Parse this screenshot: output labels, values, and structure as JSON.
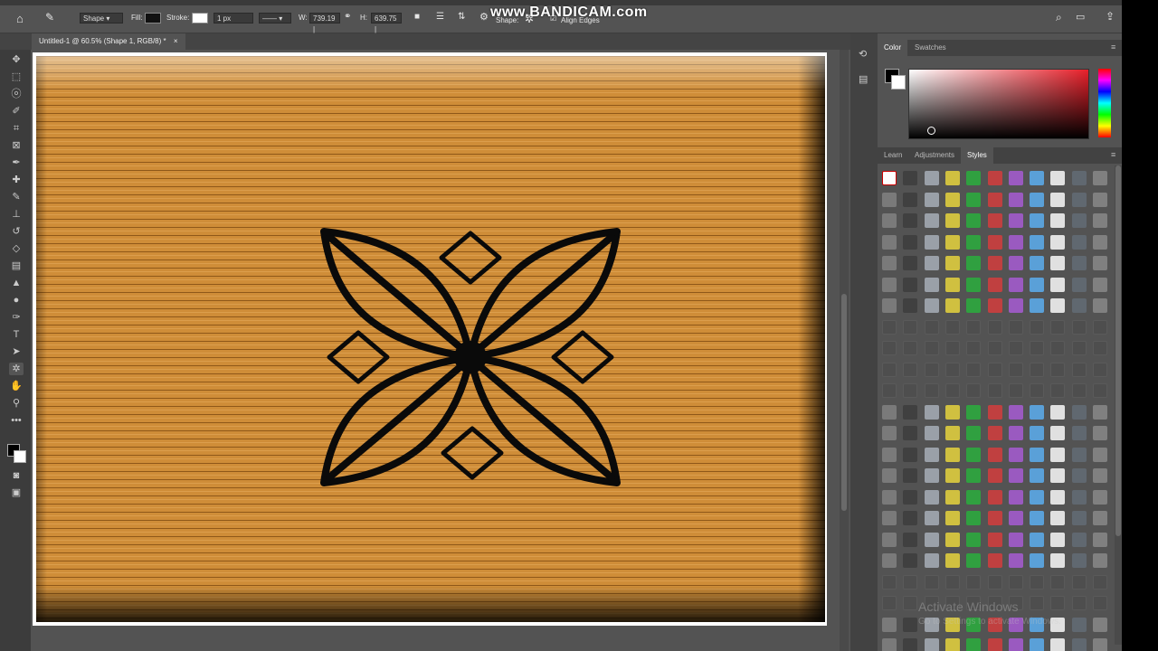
{
  "watermark": "www.BANDICAM.com",
  "options_bar": {
    "shape_mode": "Shape",
    "fill_label": "Fill:",
    "stroke_label": "Stroke:",
    "stroke_width": "1 px",
    "width_label": "W:",
    "width_value": "739.19 |",
    "height_label": "H:",
    "height_value": "639.75 |",
    "shape_label": "Shape:",
    "align_edges_label": "Align Edges"
  },
  "document_tab": {
    "title": "Untitled-1 @ 60.5% (Shape 1, RGB/8) *",
    "close": "×"
  },
  "tools": [
    "move-tool",
    "marquee-tool",
    "lasso-tool",
    "quick-select-tool",
    "crop-tool",
    "frame-tool",
    "eyedropper-tool",
    "healing-tool",
    "brush-tool",
    "stamp-tool",
    "history-brush-tool",
    "eraser-tool",
    "gradient-tool",
    "blur-tool",
    "dodge-tool",
    "pen-tool",
    "type-tool",
    "path-select-tool",
    "custom-shape-tool",
    "hand-tool",
    "zoom-tool",
    "more-tools"
  ],
  "color_panel": {
    "tabs": [
      "Color",
      "Swatches"
    ],
    "active_tab": "Color"
  },
  "styles_panel": {
    "tabs": [
      "Learn",
      "Adjustments",
      "Styles"
    ],
    "active_tab": "Styles"
  },
  "overlay": {
    "activate": "Activate Windows",
    "settings": "Go to Settings to activate Windows."
  },
  "colors": {
    "canvas_wood": "#cf8d38",
    "shape_stroke": "#0a0a0a",
    "panel_bg": "#535353"
  }
}
